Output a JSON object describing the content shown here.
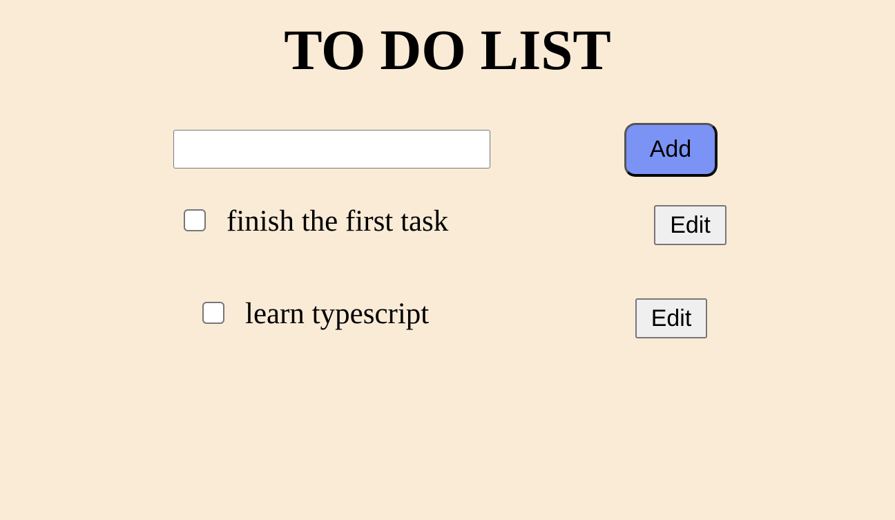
{
  "title": "TO DO LIST",
  "new_task_input": {
    "value": "",
    "placeholder": ""
  },
  "add_button_label": "Add",
  "todos": [
    {
      "text": "finish the first task",
      "checked": false,
      "edit_label": "Edit"
    },
    {
      "text": "learn typescript",
      "checked": false,
      "edit_label": "Edit"
    }
  ],
  "colors": {
    "background": "#faebd7",
    "add_button": "#7b93f5",
    "edit_button": "#efefef"
  }
}
